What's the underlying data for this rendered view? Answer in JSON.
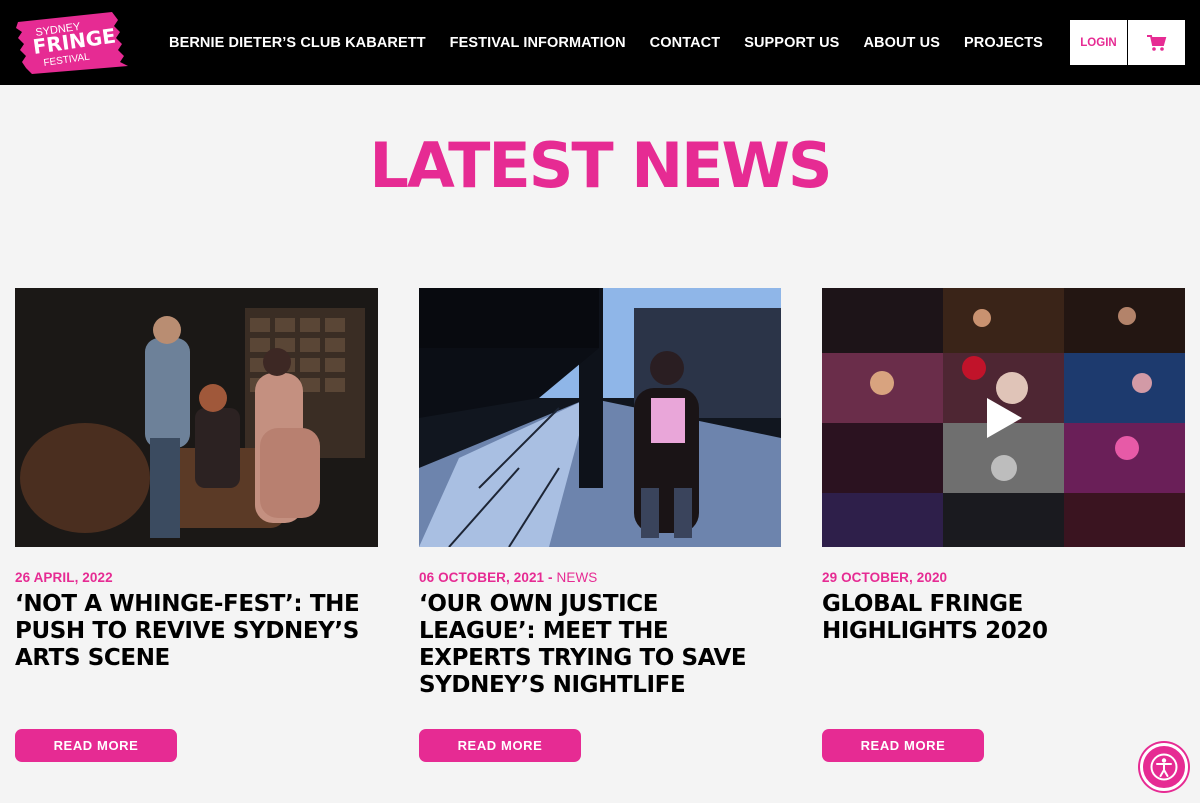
{
  "header": {
    "logo": {
      "line1": "SYDNEY",
      "line2": "FRINGE",
      "line3": "FESTIVAL"
    },
    "nav": [
      "BERNIE DIETER’S CLUB KABARETT",
      "FESTIVAL INFORMATION",
      "CONTACT",
      "SUPPORT US",
      "ABOUT US",
      "PROJECTS"
    ],
    "login_label": "LOGIN",
    "cart_icon": "cart-icon"
  },
  "main": {
    "title": "LATEST NEWS",
    "articles": [
      {
        "date": "26 APRIL, 2022",
        "category": "",
        "headline": "‘NOT A WHINGE-FEST’: THE PUSH TO REVIVE SYDNEY’S ARTS SCENE",
        "button": "READ MORE"
      },
      {
        "date": "06 OCTOBER, 2021",
        "separator": " - ",
        "category": "NEWS",
        "headline": "‘OUR OWN JUSTICE LEAGUE’: MEET THE EXPERTS TRYING TO SAVE SYDNEY’S NIGHTLIFE",
        "button": "READ MORE"
      },
      {
        "date": "29 OCTOBER, 2020",
        "category": "",
        "headline": "GLOBAL FRINGE HIGHLIGHTS 2020",
        "button": "READ MORE"
      }
    ]
  },
  "accessibility_icon": "accessibility-icon",
  "colors": {
    "brand": "#e62b93",
    "header_bg": "#000000",
    "page_bg": "#f4f4f4"
  }
}
